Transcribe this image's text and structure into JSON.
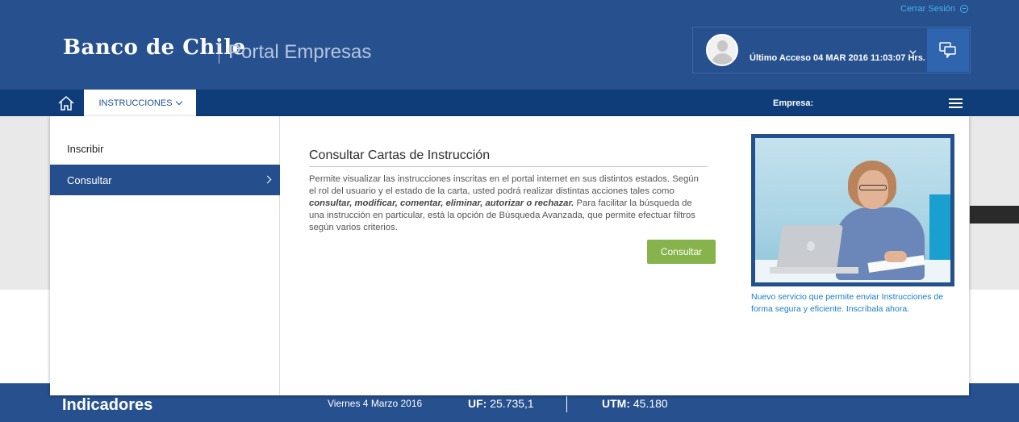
{
  "header": {
    "logout_label": "Cerrar Sesión",
    "brand": "Banco de Chile",
    "portal": "Portal Empresas",
    "last_access": "Último Acceso 04 MAR 2016 11:03:07 Hrs."
  },
  "nav": {
    "tab_label": "INSTRUCCIONES",
    "empresa_label": "Empresa:"
  },
  "menu": {
    "items": [
      {
        "label": "Inscribir",
        "active": false
      },
      {
        "label": "Consultar",
        "active": true
      }
    ]
  },
  "content": {
    "title": "Consultar Cartas de Instrucción",
    "text_before": "Permite visualizar las instrucciones inscritas en el portal internet en sus distintos estados. Según el rol del usuario y el estado de la carta, usted podrá realizar distintas acciones tales como ",
    "text_bold": "consultar, modificar, comentar, eliminar, autorizar o rechazar.",
    "text_after": " Para facilitar la búsqueda de una instrucción en particular, está la opción de Búsqueda Avanzada, que permite efectuar filtros según varios criterios.",
    "button_label": "Consultar"
  },
  "promo": {
    "caption": "Nuevo servicio que permite enviar Instrucciones de forma segura y eficiente. Inscríbala ahora."
  },
  "footer": {
    "title": "Indicadores",
    "date": "Viernes 4 Marzo 2016",
    "uf_label": "UF:",
    "uf_value": "25.735,1",
    "utm_label": "UTM:",
    "utm_value": "45.180"
  },
  "colors": {
    "header_bg": "#26508e",
    "nav_bg": "#0e3d7a",
    "accent_link": "#47b3ea",
    "button_green": "#86b34b",
    "active_item": "#254e8c"
  },
  "icons": [
    "logout-icon",
    "avatar-icon",
    "chevron-down-icon",
    "chat-icon",
    "home-icon",
    "hamburger-icon",
    "chevron-right-icon"
  ]
}
